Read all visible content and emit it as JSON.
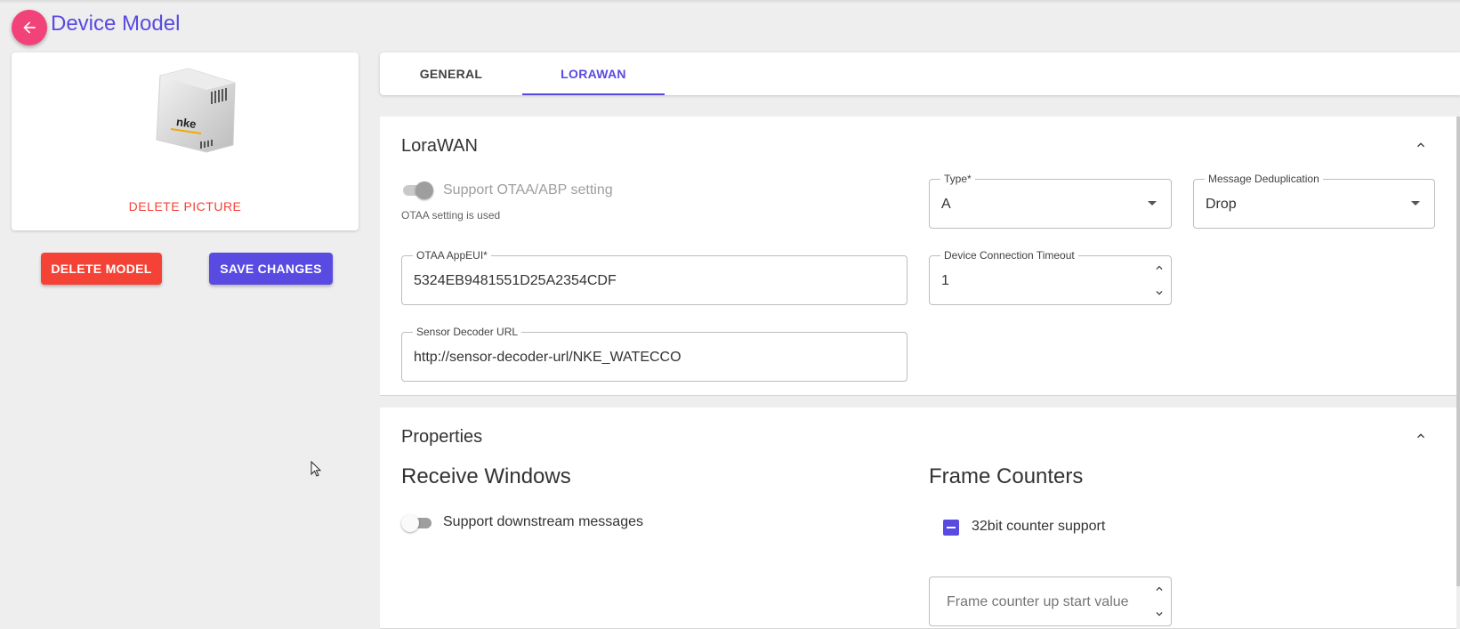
{
  "header": {
    "title": "Device Model",
    "back_icon": "arrow-left-icon",
    "accent": "#594ae2",
    "back_color": "#f2427a"
  },
  "picture_card": {
    "image_alt": "nke device",
    "image_brand_text": "nke",
    "delete_picture_label": "DELETE PICTURE"
  },
  "actions": {
    "delete_model_label": "DELETE MODEL",
    "save_changes_label": "SAVE CHANGES",
    "delete_color": "#f44336",
    "save_color": "#594ae2"
  },
  "tabs": [
    {
      "label": "GENERAL",
      "active": false
    },
    {
      "label": "LORAWAN",
      "active": true
    }
  ],
  "lorawan_panel": {
    "title": "LoraWAN",
    "otaa_toggle_label": "Support OTAA/ABP setting",
    "otaa_toggle_on": true,
    "otaa_toggle_disabled": true,
    "otaa_helper": "OTAA setting is used",
    "type_field": {
      "label": "Type*",
      "value": "A"
    },
    "dedup_field": {
      "label": "Message Deduplication",
      "value": "Drop"
    },
    "appeui_field": {
      "label": "OTAA AppEUI*",
      "value": "5324EB9481551D25A2354CDF"
    },
    "timeout_field": {
      "label": "Device Connection Timeout",
      "value": "1"
    },
    "decoder_field": {
      "label": "Sensor Decoder URL",
      "value": "http://sensor-decoder-url/NKE_WATECCO"
    }
  },
  "properties_panel": {
    "title": "Properties",
    "receive_windows_heading": "Receive Windows",
    "downstream_toggle_label": "Support downstream messages",
    "downstream_toggle_on": false,
    "frame_counters_heading": "Frame Counters",
    "counter_checkbox_label": "32bit counter support",
    "counter_checkbox_state": "indeterminate",
    "frame_counter_placeholder": "Frame counter up start value"
  }
}
